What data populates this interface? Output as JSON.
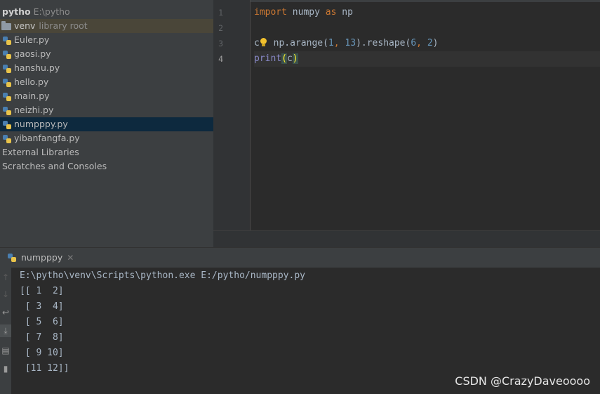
{
  "project_tree": {
    "root_name": "pytho",
    "root_path": "E:\\pytho",
    "venv": {
      "name": "venv",
      "hint": "library root"
    },
    "files": [
      "Euler.py",
      "gaosi.py",
      "hanshu.py",
      "hello.py",
      "main.py",
      "neizhi.py",
      "numpppy.py",
      "yibanfangfa.py"
    ],
    "selected_file": "numpppy.py",
    "extra_items": [
      "External Libraries",
      "Scratches and Consoles"
    ]
  },
  "editor": {
    "line_numbers": [
      "1",
      "2",
      "3",
      "4"
    ],
    "line1": {
      "kw_import": "import",
      "module": " numpy ",
      "kw_as": "as",
      "alias": " np"
    },
    "line3": {
      "var": "c",
      "assign": " np.arange(",
      "arg1": "1",
      "comma": ", ",
      "arg2": "13",
      "mid": ").reshape(",
      "arg3": "6",
      "comma2": ", ",
      "arg4": "2",
      "end": ")"
    },
    "line4": {
      "func": "print",
      "open": "(",
      "arg": "c",
      "close": ")"
    }
  },
  "run_panel": {
    "tab_label": "numpppy",
    "command": "E:\\pytho\\venv\\Scripts\\python.exe E:/pytho/numpppy.py",
    "output_lines": [
      "[[ 1  2]",
      " [ 3  4]",
      " [ 5  6]",
      " [ 7  8]",
      " [ 9 10]",
      " [11 12]]"
    ]
  },
  "watermark": "CSDN @CrazyDaveoooo",
  "colors": {
    "keyword": "#cc7832",
    "number": "#6897bb",
    "builtin": "#8888c6",
    "selection": "#0d293e"
  }
}
